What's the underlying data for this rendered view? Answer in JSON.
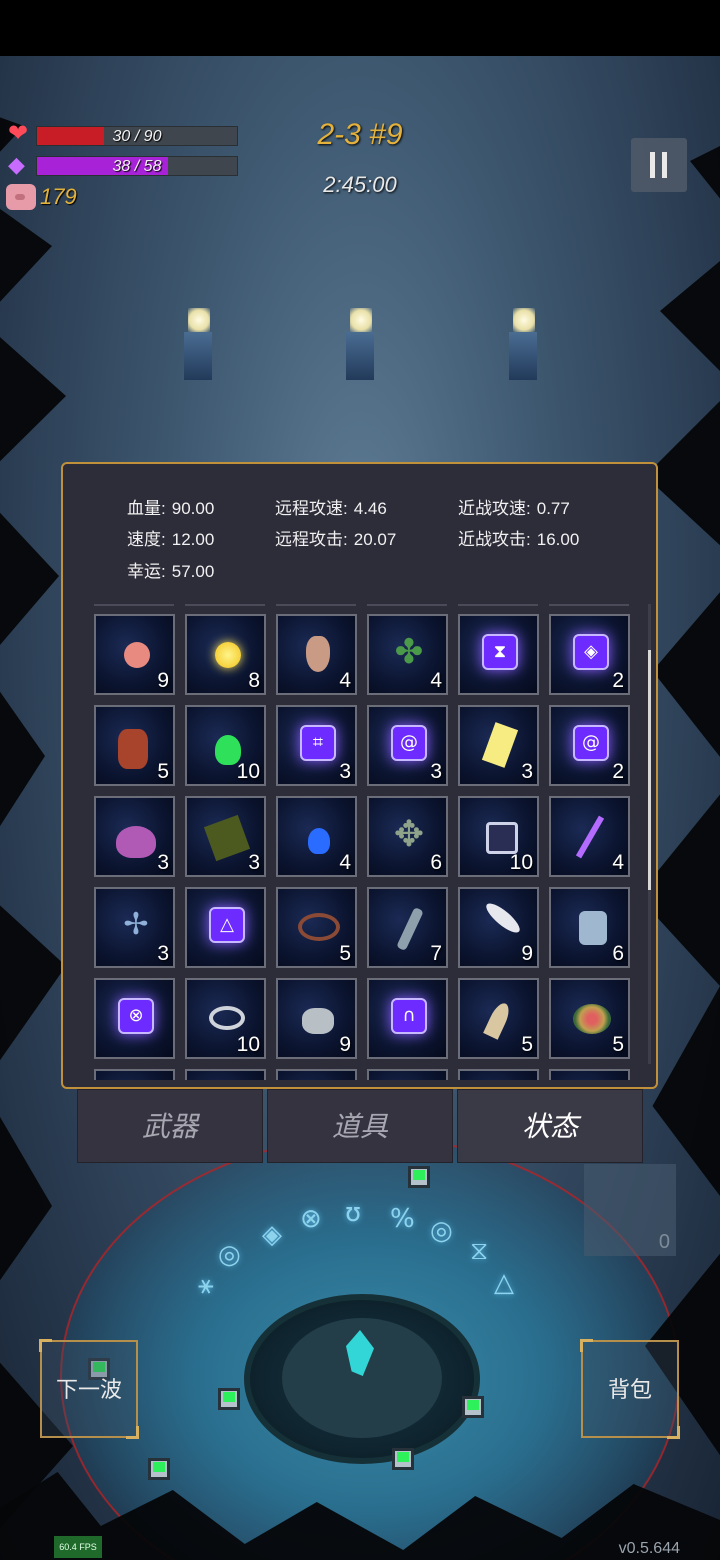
{
  "hud": {
    "hp": {
      "current": 30,
      "max": 90,
      "text": "30 / 90",
      "fill_ratio": 0.333
    },
    "mp": {
      "current": 38,
      "max": 58,
      "text": "38 / 58",
      "fill_ratio": 0.655
    },
    "gold": "179",
    "stage": "2-3 #9",
    "timer": "2:45:00"
  },
  "stats": {
    "hp": {
      "label": "血量:",
      "value": "90.00"
    },
    "ranged_speed": {
      "label": "远程攻速:",
      "value": "4.46"
    },
    "melee_speed": {
      "label": "近战攻速:",
      "value": "0.77"
    },
    "speed": {
      "label": "速度:",
      "value": "12.00"
    },
    "ranged_attack": {
      "label": "远程攻击:",
      "value": "20.07"
    },
    "melee_attack": {
      "label": "近战攻击:",
      "value": "16.00"
    },
    "luck": {
      "label": "幸运:",
      "value": "57.00"
    }
  },
  "items": [
    {
      "name": "peach-icon",
      "count": "9"
    },
    {
      "name": "gold-coin-icon",
      "count": "8"
    },
    {
      "name": "pouch-icon",
      "count": "4"
    },
    {
      "name": "clover-icon",
      "count": "4"
    },
    {
      "name": "hourglass-rune-icon",
      "count": ""
    },
    {
      "name": "eye-rune-icon",
      "count": "2"
    },
    {
      "name": "burning-heart-icon",
      "count": "5"
    },
    {
      "name": "green-potion-icon",
      "count": "10"
    },
    {
      "name": "cross-rune-icon",
      "count": "3"
    },
    {
      "name": "spiral-rune-icon",
      "count": "3"
    },
    {
      "name": "yellow-card-icon",
      "count": "3"
    },
    {
      "name": "swirl-rune-icon",
      "count": "2"
    },
    {
      "name": "pink-slime-icon",
      "count": "3"
    },
    {
      "name": "skull-book-icon",
      "count": "3"
    },
    {
      "name": "blue-potion-icon",
      "count": "4"
    },
    {
      "name": "squid-icon",
      "count": "6"
    },
    {
      "name": "medkit-icon",
      "count": "10"
    },
    {
      "name": "purple-wand-icon",
      "count": "4"
    },
    {
      "name": "dragonfly-icon",
      "count": "3"
    },
    {
      "name": "triangle-rune-icon",
      "count": ""
    },
    {
      "name": "thorn-wreath-icon",
      "count": "5"
    },
    {
      "name": "bottle-icon",
      "count": "7"
    },
    {
      "name": "feather-icon",
      "count": "9"
    },
    {
      "name": "hammer-icon",
      "count": "6"
    },
    {
      "name": "cross-circle-rune-icon",
      "count": ""
    },
    {
      "name": "rings-icon",
      "count": "10"
    },
    {
      "name": "stone-icon",
      "count": "9"
    },
    {
      "name": "curve-rune-icon",
      "count": ""
    },
    {
      "name": "horn-icon",
      "count": "5"
    },
    {
      "name": "flower-wreath-icon",
      "count": "5"
    }
  ],
  "tabs": [
    "武器",
    "道具",
    "状态"
  ],
  "active_tab": 2,
  "buttons": {
    "next_wave": "下一波",
    "backpack": "背包"
  },
  "side_slot_count": "0",
  "fps": "60.4 FPS",
  "version": "v0.5.644",
  "colors": {
    "hp": "#c81d26",
    "mp": "#a823d8",
    "gold": "#e1b23b",
    "panel_border": "#c0913a"
  }
}
